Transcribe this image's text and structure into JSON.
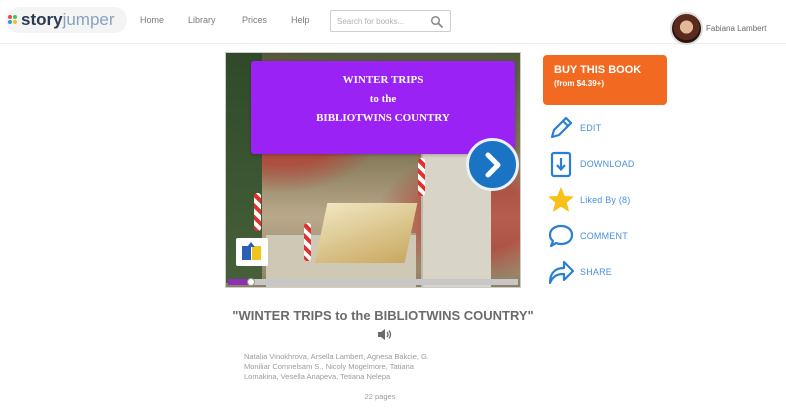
{
  "header": {
    "logo": {
      "word1": "story",
      "word2": "jumper"
    },
    "nav": [
      "Home",
      "Library",
      "Prices",
      "Help"
    ],
    "search": {
      "placeholder": "Search for books...",
      "icon": "search-icon"
    },
    "user": {
      "name": "Fabiana Lambert"
    }
  },
  "book": {
    "title_card": {
      "line1": "WINTER TRIPS",
      "line2": "to the",
      "line3": "BIBLIOTWINS COUNTRY"
    },
    "next_icon": "chevron-right-icon",
    "progress": 0.08
  },
  "actions": {
    "buy": {
      "line1": "BUY THIS BOOK",
      "line2": "(from $4.39+)"
    },
    "items": [
      {
        "label": "EDIT",
        "icon": "pencil-icon"
      },
      {
        "label": "DOWNLOAD",
        "icon": "download-icon"
      },
      {
        "label": "Liked By (8)",
        "icon": "star-icon"
      },
      {
        "label": "COMMENT",
        "icon": "comment-icon"
      },
      {
        "label": "SHARE",
        "icon": "share-icon"
      }
    ]
  },
  "details": {
    "title": "\"WINTER TRIPS to the BIBLIOTWINS COUNTRY\"",
    "speaker_icon": "speaker-icon",
    "authors_line1": "Natalia Vinokhrova, Arsella Lambert, Agnesa Bakcie, G.",
    "authors_line2": "Moniliar Comnelsam S., Nicoly Mogelmore, Tatiana",
    "authors_line3": "Lomakina, Vesella Anapeva, Tetiana Nelepa",
    "pages": "22 pages"
  },
  "colors": {
    "buy": "#f26a21",
    "title_card": "#9b22f4",
    "next": "#1b73c4",
    "action_text": "#4a90d9",
    "star": "#f6c21a"
  }
}
